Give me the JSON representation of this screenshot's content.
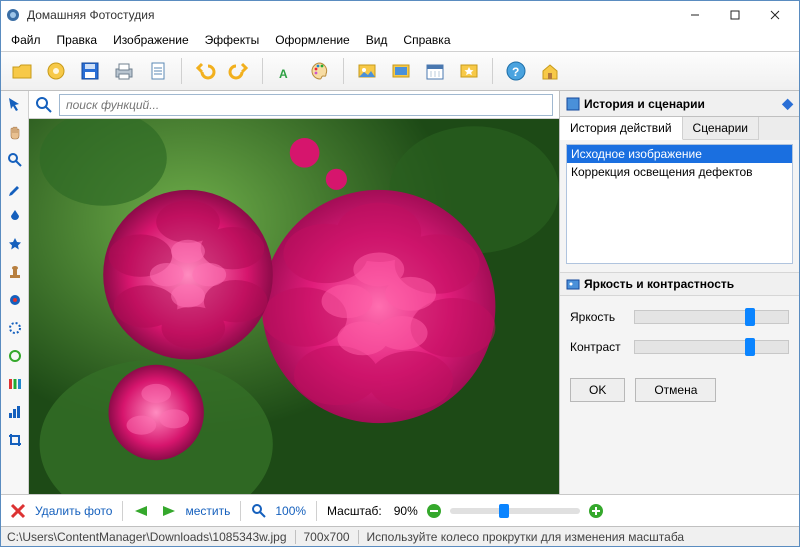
{
  "window": {
    "title": "Домашняя Фотостудия"
  },
  "menubar": [
    "Файл",
    "Правка",
    "Изображение",
    "Эффекты",
    "Оформление",
    "Вид",
    "Справка"
  ],
  "search": {
    "placeholder": "поиск функций..."
  },
  "right": {
    "history_title": "История и сценарии",
    "tabs": {
      "history": "История действий",
      "scenarios": "Сценарии"
    },
    "history_items": [
      "Исходное изображение",
      "Коррекция освещения дефектов"
    ],
    "brightness_title": "Яркость и контрастность",
    "brightness_label": "Яркость",
    "contrast_label": "Контраст",
    "ok": "OK",
    "cancel": "Отмена"
  },
  "bottom": {
    "delete": "Удалить фото",
    "move": "местить",
    "zoom_link": "100%",
    "scale_label": "Масштаб:",
    "scale_value": "90%"
  },
  "status": {
    "path": "C:\\Users\\ContentManager\\Downloads\\1085343w.jpg",
    "dims": "700x700",
    "hint": "Используйте колесо прокрутки для изменения масштаба"
  }
}
